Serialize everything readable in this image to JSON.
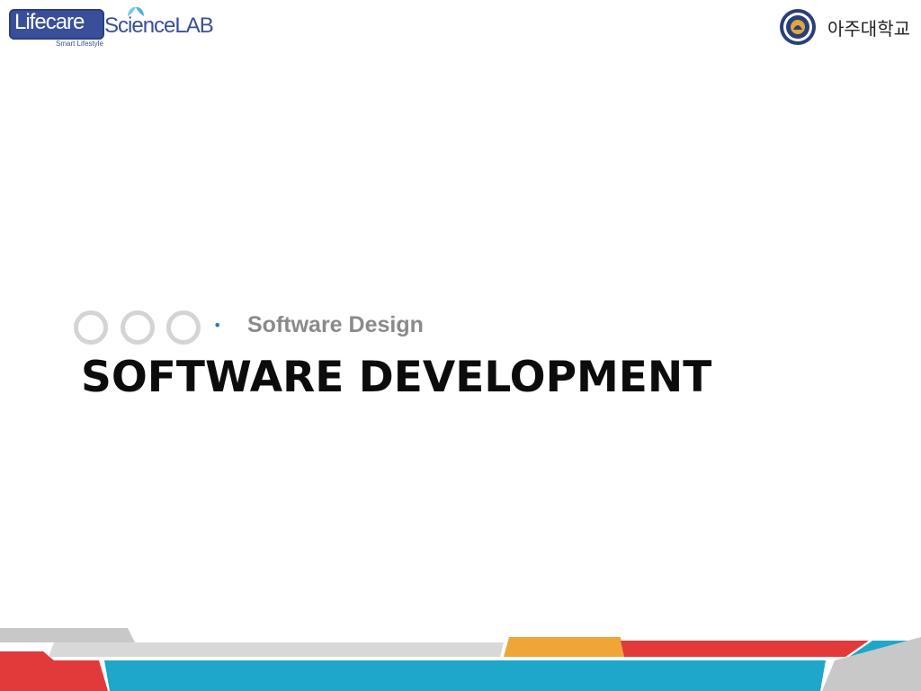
{
  "header": {
    "lab_logo": {
      "word1": "Lifecare",
      "word2": "ScienceLAB",
      "tagline": "Smart Lifestyle"
    },
    "university": {
      "name": "아주대학교",
      "seal_icon": "ajou-university-seal-icon"
    }
  },
  "content": {
    "subtitle": "Software Design",
    "title": "SOFTWARE DEVELOPMENT"
  },
  "colors": {
    "lab_blue": "#3a4f9a",
    "bullet_blue": "#1f7fc4",
    "footer_red": "#e2393b",
    "footer_cyan": "#1ea7c9",
    "footer_orange": "#f0a537",
    "footer_gray": "#c8c8c8"
  }
}
